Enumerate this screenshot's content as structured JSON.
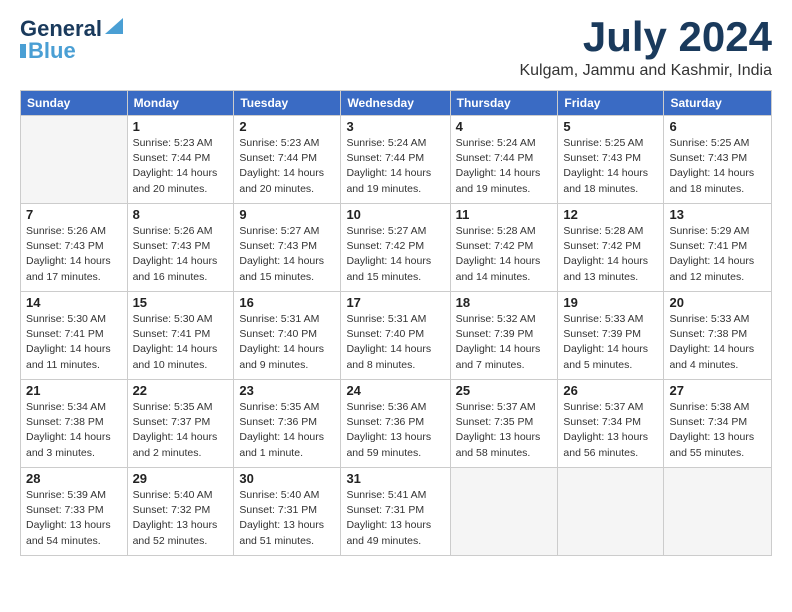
{
  "logo": {
    "part1": "General",
    "part2": "Blue"
  },
  "title": "July 2024",
  "subtitle": "Kulgam, Jammu and Kashmir, India",
  "days_of_week": [
    "Sunday",
    "Monday",
    "Tuesday",
    "Wednesday",
    "Thursday",
    "Friday",
    "Saturday"
  ],
  "weeks": [
    [
      {
        "day": "",
        "sunrise": "",
        "sunset": "",
        "daylight": ""
      },
      {
        "day": "1",
        "sunrise": "Sunrise: 5:23 AM",
        "sunset": "Sunset: 7:44 PM",
        "daylight": "Daylight: 14 hours and 20 minutes."
      },
      {
        "day": "2",
        "sunrise": "Sunrise: 5:23 AM",
        "sunset": "Sunset: 7:44 PM",
        "daylight": "Daylight: 14 hours and 20 minutes."
      },
      {
        "day": "3",
        "sunrise": "Sunrise: 5:24 AM",
        "sunset": "Sunset: 7:44 PM",
        "daylight": "Daylight: 14 hours and 19 minutes."
      },
      {
        "day": "4",
        "sunrise": "Sunrise: 5:24 AM",
        "sunset": "Sunset: 7:44 PM",
        "daylight": "Daylight: 14 hours and 19 minutes."
      },
      {
        "day": "5",
        "sunrise": "Sunrise: 5:25 AM",
        "sunset": "Sunset: 7:43 PM",
        "daylight": "Daylight: 14 hours and 18 minutes."
      },
      {
        "day": "6",
        "sunrise": "Sunrise: 5:25 AM",
        "sunset": "Sunset: 7:43 PM",
        "daylight": "Daylight: 14 hours and 18 minutes."
      }
    ],
    [
      {
        "day": "7",
        "sunrise": "Sunrise: 5:26 AM",
        "sunset": "Sunset: 7:43 PM",
        "daylight": "Daylight: 14 hours and 17 minutes."
      },
      {
        "day": "8",
        "sunrise": "Sunrise: 5:26 AM",
        "sunset": "Sunset: 7:43 PM",
        "daylight": "Daylight: 14 hours and 16 minutes."
      },
      {
        "day": "9",
        "sunrise": "Sunrise: 5:27 AM",
        "sunset": "Sunset: 7:43 PM",
        "daylight": "Daylight: 14 hours and 15 minutes."
      },
      {
        "day": "10",
        "sunrise": "Sunrise: 5:27 AM",
        "sunset": "Sunset: 7:42 PM",
        "daylight": "Daylight: 14 hours and 15 minutes."
      },
      {
        "day": "11",
        "sunrise": "Sunrise: 5:28 AM",
        "sunset": "Sunset: 7:42 PM",
        "daylight": "Daylight: 14 hours and 14 minutes."
      },
      {
        "day": "12",
        "sunrise": "Sunrise: 5:28 AM",
        "sunset": "Sunset: 7:42 PM",
        "daylight": "Daylight: 14 hours and 13 minutes."
      },
      {
        "day": "13",
        "sunrise": "Sunrise: 5:29 AM",
        "sunset": "Sunset: 7:41 PM",
        "daylight": "Daylight: 14 hours and 12 minutes."
      }
    ],
    [
      {
        "day": "14",
        "sunrise": "Sunrise: 5:30 AM",
        "sunset": "Sunset: 7:41 PM",
        "daylight": "Daylight: 14 hours and 11 minutes."
      },
      {
        "day": "15",
        "sunrise": "Sunrise: 5:30 AM",
        "sunset": "Sunset: 7:41 PM",
        "daylight": "Daylight: 14 hours and 10 minutes."
      },
      {
        "day": "16",
        "sunrise": "Sunrise: 5:31 AM",
        "sunset": "Sunset: 7:40 PM",
        "daylight": "Daylight: 14 hours and 9 minutes."
      },
      {
        "day": "17",
        "sunrise": "Sunrise: 5:31 AM",
        "sunset": "Sunset: 7:40 PM",
        "daylight": "Daylight: 14 hours and 8 minutes."
      },
      {
        "day": "18",
        "sunrise": "Sunrise: 5:32 AM",
        "sunset": "Sunset: 7:39 PM",
        "daylight": "Daylight: 14 hours and 7 minutes."
      },
      {
        "day": "19",
        "sunrise": "Sunrise: 5:33 AM",
        "sunset": "Sunset: 7:39 PM",
        "daylight": "Daylight: 14 hours and 5 minutes."
      },
      {
        "day": "20",
        "sunrise": "Sunrise: 5:33 AM",
        "sunset": "Sunset: 7:38 PM",
        "daylight": "Daylight: 14 hours and 4 minutes."
      }
    ],
    [
      {
        "day": "21",
        "sunrise": "Sunrise: 5:34 AM",
        "sunset": "Sunset: 7:38 PM",
        "daylight": "Daylight: 14 hours and 3 minutes."
      },
      {
        "day": "22",
        "sunrise": "Sunrise: 5:35 AM",
        "sunset": "Sunset: 7:37 PM",
        "daylight": "Daylight: 14 hours and 2 minutes."
      },
      {
        "day": "23",
        "sunrise": "Sunrise: 5:35 AM",
        "sunset": "Sunset: 7:36 PM",
        "daylight": "Daylight: 14 hours and 1 minute."
      },
      {
        "day": "24",
        "sunrise": "Sunrise: 5:36 AM",
        "sunset": "Sunset: 7:36 PM",
        "daylight": "Daylight: 13 hours and 59 minutes."
      },
      {
        "day": "25",
        "sunrise": "Sunrise: 5:37 AM",
        "sunset": "Sunset: 7:35 PM",
        "daylight": "Daylight: 13 hours and 58 minutes."
      },
      {
        "day": "26",
        "sunrise": "Sunrise: 5:37 AM",
        "sunset": "Sunset: 7:34 PM",
        "daylight": "Daylight: 13 hours and 56 minutes."
      },
      {
        "day": "27",
        "sunrise": "Sunrise: 5:38 AM",
        "sunset": "Sunset: 7:34 PM",
        "daylight": "Daylight: 13 hours and 55 minutes."
      }
    ],
    [
      {
        "day": "28",
        "sunrise": "Sunrise: 5:39 AM",
        "sunset": "Sunset: 7:33 PM",
        "daylight": "Daylight: 13 hours and 54 minutes."
      },
      {
        "day": "29",
        "sunrise": "Sunrise: 5:40 AM",
        "sunset": "Sunset: 7:32 PM",
        "daylight": "Daylight: 13 hours and 52 minutes."
      },
      {
        "day": "30",
        "sunrise": "Sunrise: 5:40 AM",
        "sunset": "Sunset: 7:31 PM",
        "daylight": "Daylight: 13 hours and 51 minutes."
      },
      {
        "day": "31",
        "sunrise": "Sunrise: 5:41 AM",
        "sunset": "Sunset: 7:31 PM",
        "daylight": "Daylight: 13 hours and 49 minutes."
      },
      {
        "day": "",
        "sunrise": "",
        "sunset": "",
        "daylight": ""
      },
      {
        "day": "",
        "sunrise": "",
        "sunset": "",
        "daylight": ""
      },
      {
        "day": "",
        "sunrise": "",
        "sunset": "",
        "daylight": ""
      }
    ]
  ]
}
